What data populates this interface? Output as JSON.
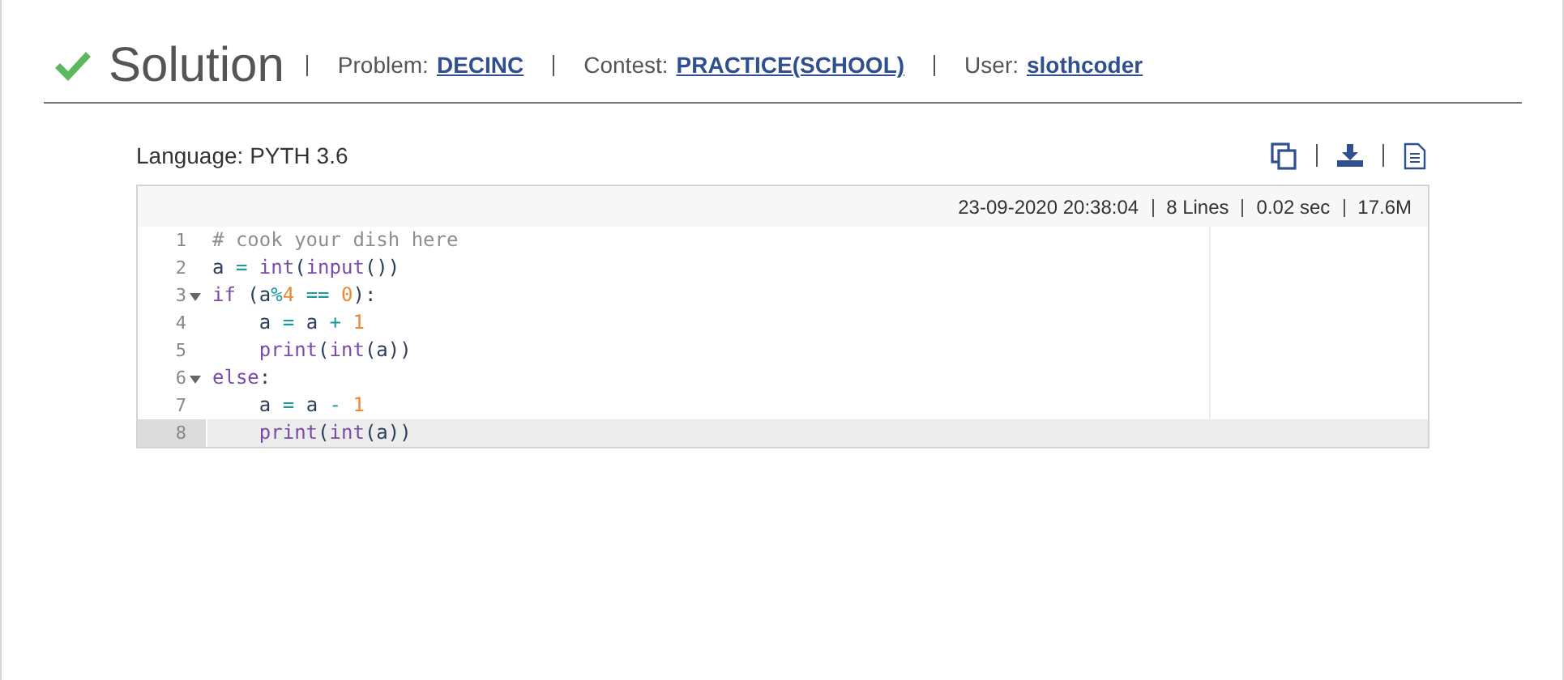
{
  "header": {
    "title": "Solution",
    "fields": [
      {
        "label": "Problem:",
        "link": "DECINC"
      },
      {
        "label": "Contest:",
        "link": "PRACTICE(SCHOOL)"
      },
      {
        "label": "User:",
        "link": "slothcoder"
      }
    ]
  },
  "language": "Language: PYTH 3.6",
  "toolbar": [
    {
      "kind": "copy"
    },
    {
      "kind": "download"
    },
    {
      "kind": "file"
    }
  ],
  "meta": [
    "23-09-2020 20:38:04",
    "8 Lines",
    "0.02 sec",
    "17.6M"
  ],
  "code": [
    {
      "number": "1",
      "foldable": false,
      "selected": false,
      "tokens": [
        {
          "kind": "comment",
          "text": "# cook your dish here"
        }
      ]
    },
    {
      "number": "2",
      "foldable": false,
      "selected": false,
      "tokens": [
        {
          "kind": "name",
          "text": "a "
        },
        {
          "kind": "op",
          "text": "= "
        },
        {
          "kind": "keyword",
          "text": "int"
        },
        {
          "kind": "name",
          "text": "("
        },
        {
          "kind": "keyword",
          "text": "input"
        },
        {
          "kind": "name",
          "text": "())"
        }
      ]
    },
    {
      "number": "3",
      "foldable": true,
      "selected": false,
      "tokens": [
        {
          "kind": "keyword",
          "text": "if"
        },
        {
          "kind": "name",
          "text": " (a"
        },
        {
          "kind": "op",
          "text": "%"
        },
        {
          "kind": "number",
          "text": "4 "
        },
        {
          "kind": "op",
          "text": "== "
        },
        {
          "kind": "number",
          "text": "0"
        },
        {
          "kind": "name",
          "text": "):"
        }
      ]
    },
    {
      "number": "4",
      "foldable": false,
      "selected": false,
      "tokens": [
        {
          "kind": "name",
          "text": "    a "
        },
        {
          "kind": "op",
          "text": "= "
        },
        {
          "kind": "name",
          "text": "a "
        },
        {
          "kind": "op",
          "text": "+ "
        },
        {
          "kind": "number",
          "text": "1"
        }
      ]
    },
    {
      "number": "5",
      "foldable": false,
      "selected": false,
      "tokens": [
        {
          "kind": "keyword",
          "text": "    print"
        },
        {
          "kind": "name",
          "text": "("
        },
        {
          "kind": "keyword",
          "text": "int"
        },
        {
          "kind": "name",
          "text": "(a))"
        }
      ]
    },
    {
      "number": "6",
      "foldable": true,
      "selected": false,
      "tokens": [
        {
          "kind": "keyword",
          "text": "else"
        },
        {
          "kind": "name",
          "text": ":"
        }
      ]
    },
    {
      "number": "7",
      "foldable": false,
      "selected": false,
      "tokens": [
        {
          "kind": "name",
          "text": "    a "
        },
        {
          "kind": "op",
          "text": "= "
        },
        {
          "kind": "name",
          "text": "a "
        },
        {
          "kind": "op",
          "text": "- "
        },
        {
          "kind": "number",
          "text": "1"
        }
      ]
    },
    {
      "number": "8",
      "foldable": false,
      "selected": true,
      "tokens": [
        {
          "kind": "keyword",
          "text": "    print"
        },
        {
          "kind": "name",
          "text": "("
        },
        {
          "kind": "keyword",
          "text": "int"
        },
        {
          "kind": "name",
          "text": "(a))"
        }
      ]
    }
  ]
}
